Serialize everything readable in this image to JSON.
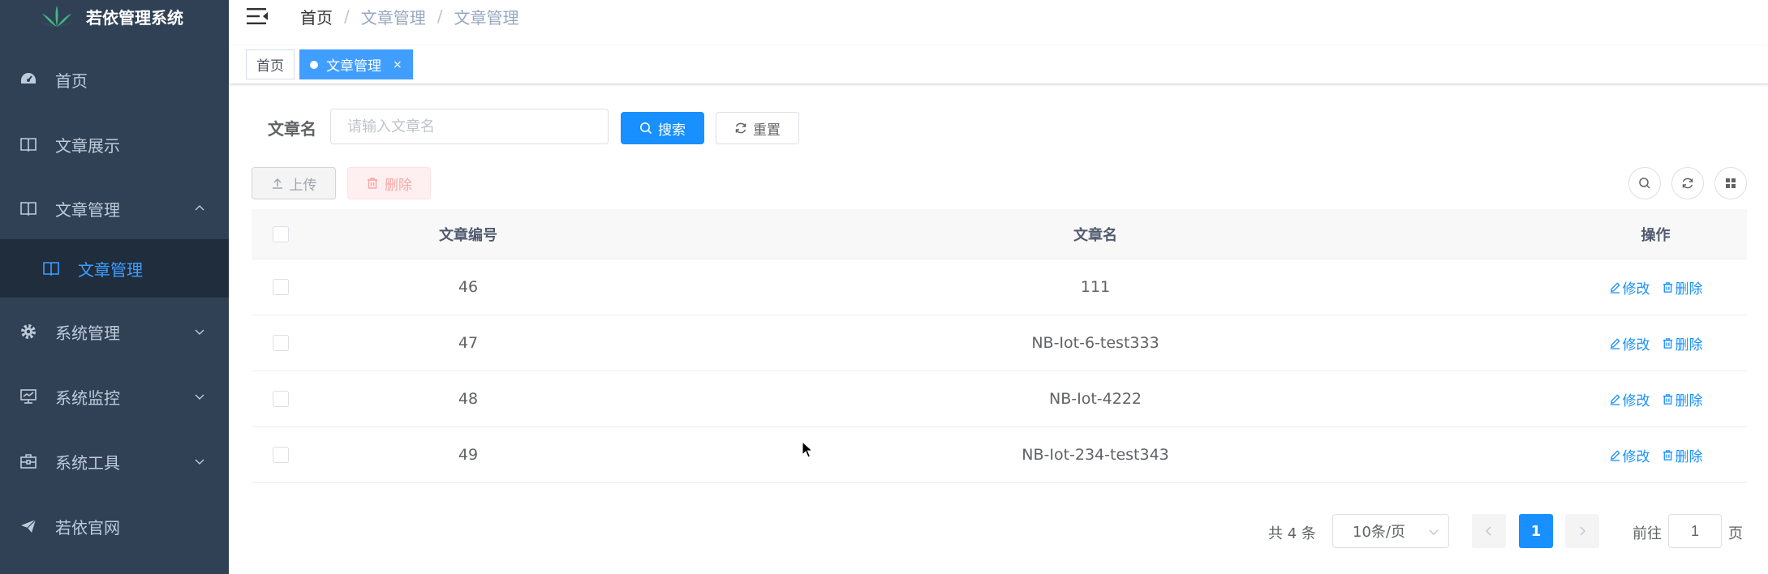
{
  "app": {
    "title": "若依管理系统"
  },
  "colors": {
    "sidebar_bg": "#304156",
    "submenu_bg": "#1f2d3d",
    "primary": "#1890ff",
    "menu_text": "#bfcbd9"
  },
  "sidebar": {
    "items": [
      {
        "label": "首页",
        "icon": "dashboard-icon"
      },
      {
        "label": "文章展示",
        "icon": "book-icon"
      },
      {
        "label": "文章管理",
        "icon": "book-icon",
        "expanded": true
      },
      {
        "label": "系统管理",
        "icon": "gear-icon"
      },
      {
        "label": "系统监控",
        "icon": "monitor-icon"
      },
      {
        "label": "系统工具",
        "icon": "toolbox-icon"
      },
      {
        "label": "若依官网",
        "icon": "send-icon"
      }
    ],
    "submenu": {
      "label": "文章管理",
      "icon": "book-icon",
      "active": true
    }
  },
  "breadcrumb": {
    "items": [
      "首页",
      "文章管理",
      "文章管理"
    ],
    "separator": "/"
  },
  "tags": [
    {
      "label": "首页",
      "active": false
    },
    {
      "label": "文章管理",
      "active": true,
      "close": "×"
    }
  ],
  "search": {
    "label": "文章名",
    "placeholder": "请输入文章名",
    "value": "",
    "search_button": "搜索",
    "reset_button": "重置"
  },
  "toolbar": {
    "upload_button": "上传",
    "delete_button": "删除"
  },
  "table": {
    "columns": [
      "文章编号",
      "文章名",
      "操作"
    ],
    "rows": [
      {
        "id": "46",
        "name": "111"
      },
      {
        "id": "47",
        "name": "NB-Iot-6-test333"
      },
      {
        "id": "48",
        "name": "NB-Iot-4222"
      },
      {
        "id": "49",
        "name": "NB-Iot-234-test343"
      }
    ],
    "actions": {
      "edit": "修改",
      "delete": "删除"
    }
  },
  "pagination": {
    "total_text": "共 4 条",
    "page_size": "10条/页",
    "current_page": "1",
    "jump_label": "前往",
    "jump_value": "1",
    "page_unit": "页"
  }
}
